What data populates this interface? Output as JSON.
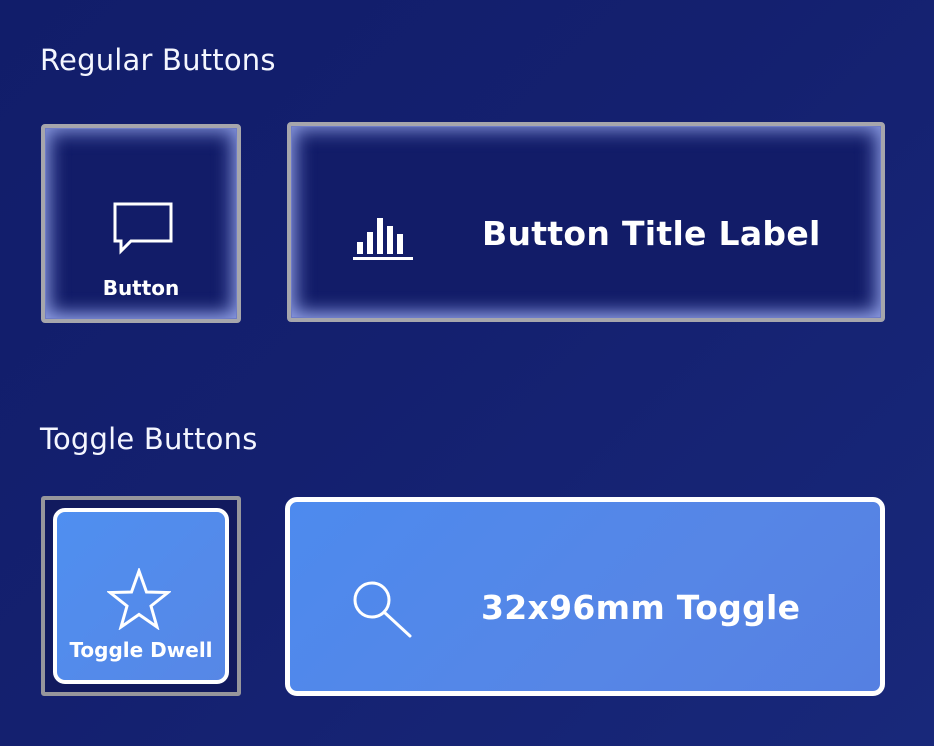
{
  "sections": {
    "regular_title": "Regular Buttons",
    "toggle_title": "Toggle Buttons"
  },
  "regular_buttons": [
    {
      "label": "Button",
      "icon": "chat-bubble-icon"
    },
    {
      "label": "Button Title Label",
      "icon": "bar-chart-icon"
    }
  ],
  "toggle_buttons": [
    {
      "label": "Toggle Dwell",
      "icon": "star-icon",
      "state": "on"
    },
    {
      "label": "32x96mm Toggle",
      "icon": "search-icon",
      "state": "on"
    }
  ],
  "colors": {
    "background": "#131e6c",
    "bevel_button_fill": "#121c68",
    "button_border": "#a6a6ac",
    "toggle_on_fill": "#5289ec",
    "toggle_on_border": "#ffffff",
    "text": "#ffffff"
  }
}
